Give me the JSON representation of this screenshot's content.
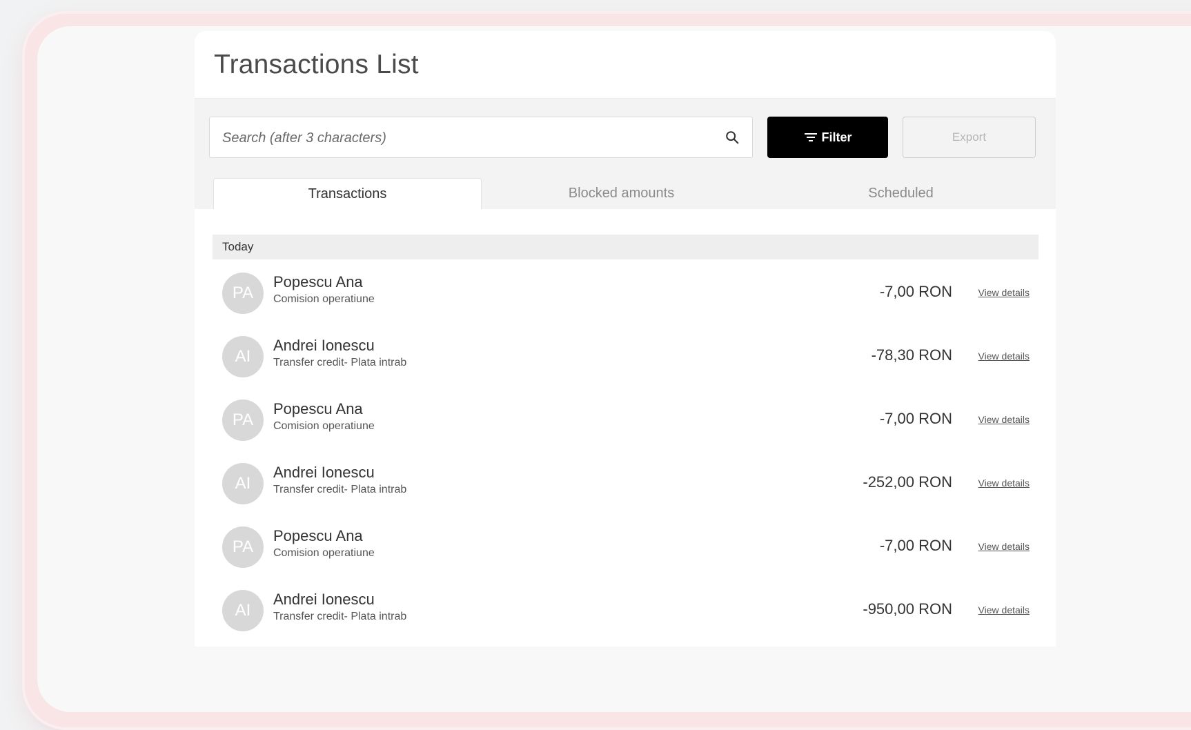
{
  "page": {
    "title": "Transactions List"
  },
  "search": {
    "placeholder": "Search (after 3 characters)",
    "value": ""
  },
  "toolbar": {
    "filter_label": "Filter",
    "export_label": "Export"
  },
  "tabs": [
    {
      "label": "Transactions",
      "active": true
    },
    {
      "label": "Blocked amounts",
      "active": false
    },
    {
      "label": "Scheduled",
      "active": false
    }
  ],
  "groups": [
    {
      "label": "Today",
      "transactions": [
        {
          "initials": "PA",
          "name": "Popescu Ana",
          "description": "Comision operatiune",
          "amount": "-7,00 RON",
          "action": "View details"
        },
        {
          "initials": "AI",
          "name": "Andrei Ionescu",
          "description": "Transfer credit- Plata intrab",
          "amount": "-78,30 RON",
          "action": "View details"
        },
        {
          "initials": "PA",
          "name": "Popescu Ana",
          "description": "Comision operatiune",
          "amount": "-7,00 RON",
          "action": "View details"
        },
        {
          "initials": "AI",
          "name": "Andrei Ionescu",
          "description": "Transfer credit- Plata intrab",
          "amount": "-252,00 RON",
          "action": "View details"
        },
        {
          "initials": "PA",
          "name": "Popescu Ana",
          "description": "Comision operatiune",
          "amount": "-7,00 RON",
          "action": "View details"
        },
        {
          "initials": "AI",
          "name": "Andrei Ionescu",
          "description": "Transfer credit- Plata intrab",
          "amount": "-950,00 RON",
          "action": "View details"
        }
      ]
    }
  ],
  "icons": {
    "search": "search-icon",
    "filter": "filter-icon"
  },
  "colors": {
    "frame": "#f9e4e6",
    "filter_button": "#000000",
    "avatar": "#d8d8d8"
  }
}
